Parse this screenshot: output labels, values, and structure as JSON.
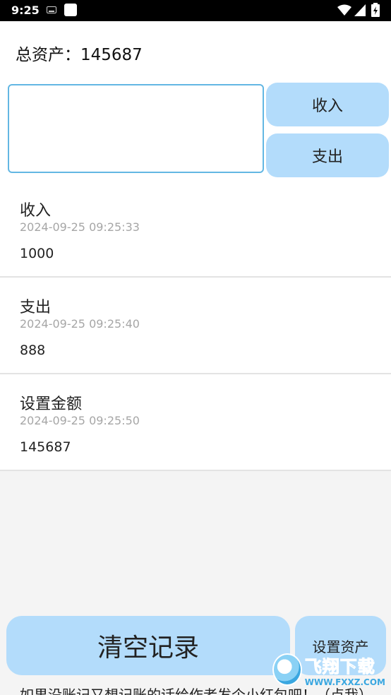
{
  "status_bar": {
    "time": "9:25",
    "icons": [
      "keyboard-icon",
      "app-icon",
      "wifi-icon",
      "signal-icon",
      "battery-icon"
    ]
  },
  "summary": {
    "total_label": "总资产：145687"
  },
  "input": {
    "value": "",
    "placeholder": ""
  },
  "actions": {
    "income_label": "收入",
    "expense_label": "支出",
    "clear_label": "清空记录",
    "set_assets_label": "设置资产"
  },
  "records": [
    {
      "type": "收入",
      "time": "2024-09-25 09:25:33",
      "amount": "1000"
    },
    {
      "type": "支出",
      "time": "2024-09-25 09:25:40",
      "amount": "888"
    },
    {
      "type": "设置金额",
      "time": "2024-09-25 09:25:50",
      "amount": "145687"
    }
  ],
  "footer": {
    "text": "如果没账记又想记账的话给作者发个小红包吧！（点我）"
  },
  "watermark": {
    "main": "飞翔下载",
    "sub": "WWW.FXXZ.COM"
  },
  "colors": {
    "button_bg": "#b3dcfb",
    "input_border": "#63b7e3",
    "secondary_text": "#a6a6a6"
  }
}
